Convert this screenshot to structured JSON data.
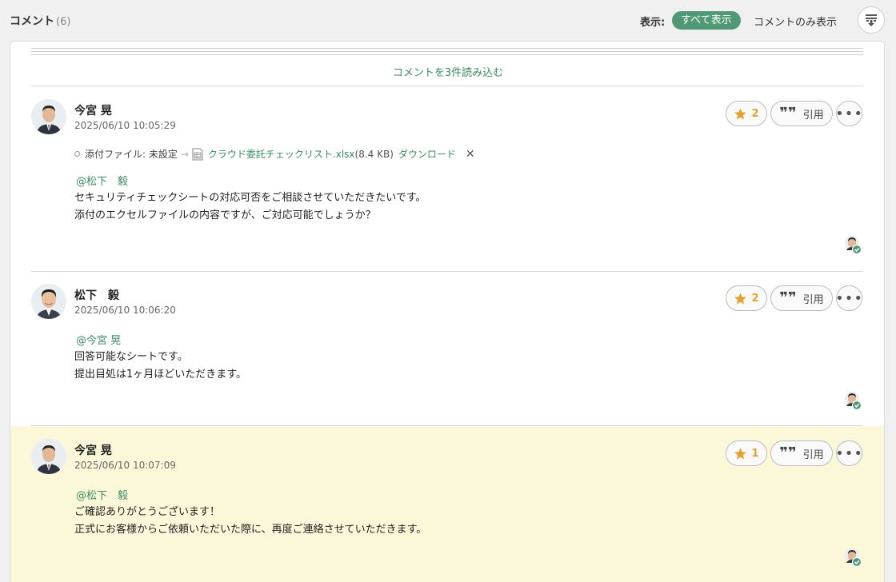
{
  "header": {
    "title": "コメント",
    "count": "(6)",
    "view_label": "表示:",
    "filter_all": "すべて表示",
    "filter_comments": "コメントのみ表示"
  },
  "load_more": "コメントを3件読み込む",
  "comments": [
    {
      "author": "今宮 晃",
      "date": "2025/06/10 10:05:29",
      "attachment": {
        "label": "添付ファイル: 未設定",
        "arrow": "→",
        "file_name": "クラウド委託チェックリスト.xlsx",
        "file_size": "(8.4 KB)",
        "download": "ダウンロード",
        "remove": "✕"
      },
      "mention": "@松下　毅",
      "lines": [
        "セキュリティチェックシートの対応可否をご相談させていただきたいです。",
        "添付のエクセルファイルの内容ですが、ご対応可能でしょうか？"
      ],
      "stars": "2",
      "quote_label": "引用"
    },
    {
      "author": "松下　毅",
      "date": "2025/06/10 10:06:20",
      "mention": "@今宮 晃",
      "lines": [
        "回答可能なシートです。",
        "提出目処は1ヶ月ほどいただきます。"
      ],
      "stars": "2",
      "quote_label": "引用"
    },
    {
      "author": "今宮 晃",
      "date": "2025/06/10 10:07:09",
      "mention": "@松下　毅",
      "lines": [
        "ご確認ありがとうございます！",
        "正式にお客様からご依頼いただいた際に、再度ご連絡させていただきます。"
      ],
      "stars": "1",
      "quote_label": "引用"
    }
  ],
  "icons": {
    "star": "star-icon",
    "quote": "quote-icon",
    "more": "more-icon",
    "sort": "sort-icon",
    "file": "spreadsheet-file-icon",
    "read": "read-check-icon"
  },
  "colors": {
    "accent": "#4f9a74",
    "link": "#3b8a66",
    "star": "#e5a12b",
    "highlight": "#fbf7d9"
  }
}
